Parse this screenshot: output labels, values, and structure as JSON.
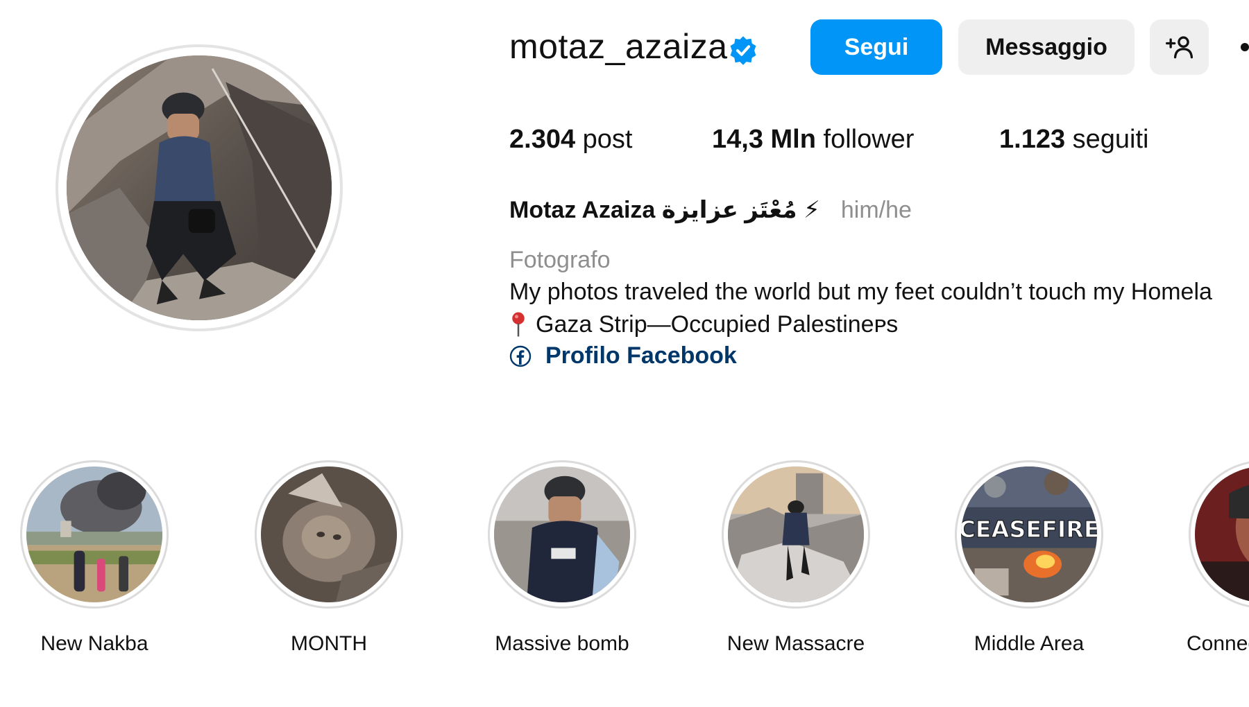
{
  "profile": {
    "username": "motaz_azaiza",
    "verified": true,
    "buttons": {
      "follow": "Segui",
      "message": "Messaggio"
    },
    "stats": {
      "posts_count": "2.304",
      "posts_label": "post",
      "followers_count": "14,3 Mln",
      "followers_label": "follower",
      "following_count": "1.123",
      "following_label": "seguiti"
    },
    "full_name": "Motaz Azaiza مُعْتَز عزايزة ⚡",
    "pronouns": "him/he",
    "category": "Fotografo",
    "bio_text": "My photos traveled the world but my feet couldn’t touch my Homela",
    "location_text": "Gaza Strip—Occupied Palestineᴘs",
    "link_text": "Profilo Facebook"
  },
  "highlights": [
    {
      "label": "New Nakba"
    },
    {
      "label": "MONTH"
    },
    {
      "label": "Massive bomb"
    },
    {
      "label": "New Massacre"
    },
    {
      "label": "Middle Area"
    },
    {
      "label": "Connec"
    }
  ],
  "highlight_image_text": {
    "ceasefire": "CEASEFIRE"
  },
  "icons": {
    "verified": "verified-badge-icon",
    "add_user": "add-user-icon",
    "more": "more-options-icon",
    "location": "location-pin-icon",
    "link": "facebook-icon"
  },
  "colors": {
    "accent_blue": "#0095f6",
    "secondary_button": "#efefef",
    "link_blue": "#00376b",
    "muted_text": "#8e8e8e"
  }
}
